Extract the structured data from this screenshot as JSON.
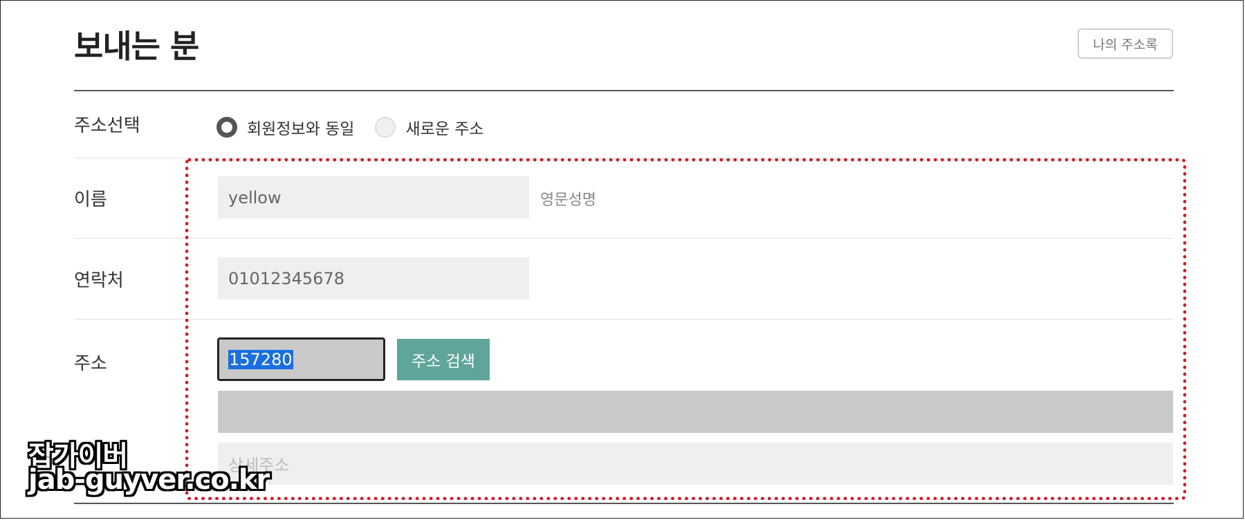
{
  "header": {
    "title": "보내는 분",
    "address_book_button": "나의 주소록"
  },
  "form": {
    "address_select": {
      "label": "주소선택",
      "options": [
        "회원정보와 동일",
        "새로운 주소"
      ],
      "selected": "회원정보와 동일"
    },
    "name": {
      "label": "이름",
      "value": "yellow",
      "hint": "영문성명"
    },
    "phone": {
      "label": "연락처",
      "value": "01012345678"
    },
    "address": {
      "label": "주소",
      "zip_value": "157280",
      "search_button": "주소 검색",
      "address_line1": "",
      "detail_placeholder": "상세주소"
    }
  },
  "watermark": {
    "line1": "잡가이버",
    "line2": "jab-guyver.co.kr"
  },
  "colors": {
    "accent_button": "#5fa59c",
    "highlight_border": "#cc1f2c",
    "selection": "#1a6fe0"
  }
}
